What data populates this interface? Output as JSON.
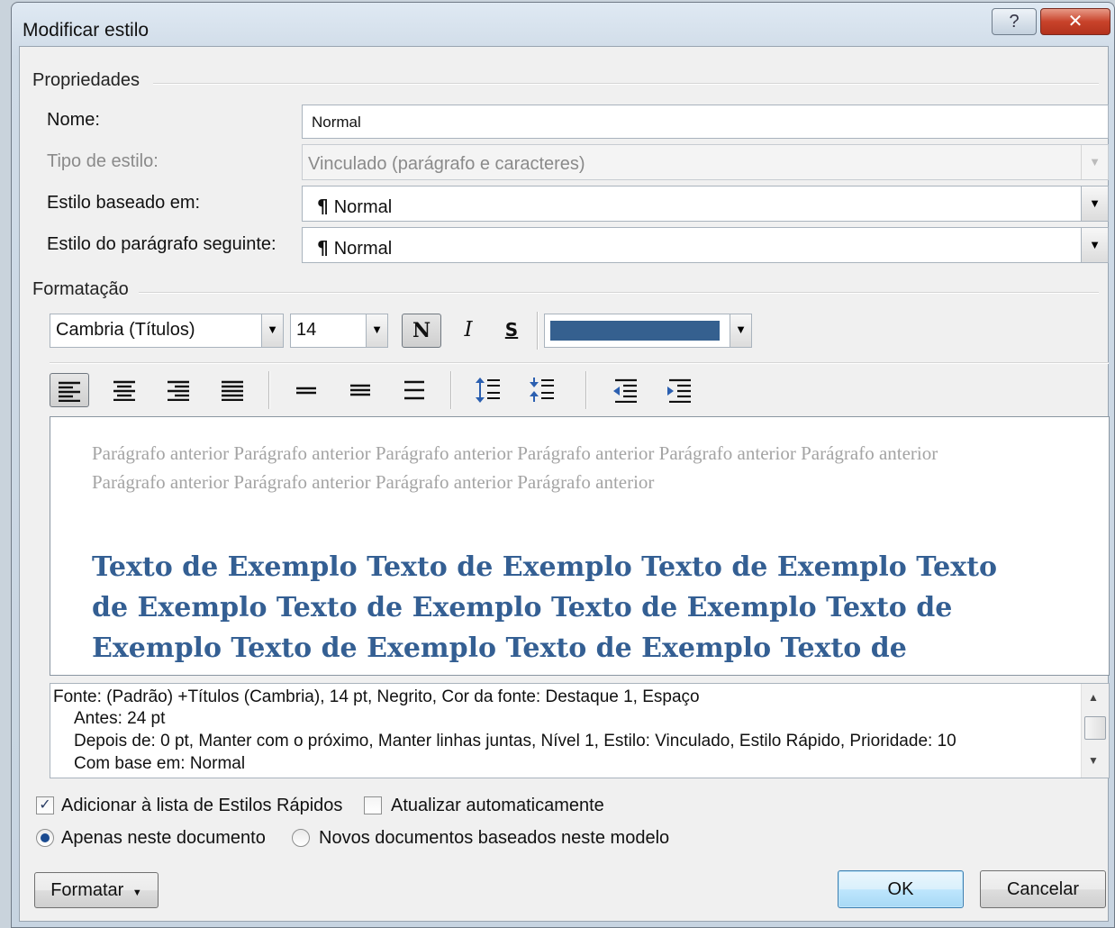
{
  "window": {
    "title": "Modificar estilo",
    "help_glyph": "?",
    "close_glyph": "✕"
  },
  "properties": {
    "group_label": "Propriedades",
    "name_label": "Nome:",
    "name_value": "Normal",
    "type_label": "Tipo de estilo:",
    "type_value": "Vinculado (parágrafo e caracteres)",
    "based_on_label": "Estilo baseado em:",
    "based_on_value": "Normal",
    "next_label": "Estilo do parágrafo seguinte:",
    "next_value": "Normal",
    "pilcrow_glyph": "¶"
  },
  "formatting": {
    "group_label": "Formatação",
    "font_value": "Cambria (Títulos)",
    "size_value": "14",
    "bold_glyph": "N",
    "italic_glyph": "I",
    "underline_glyph": "S",
    "font_color": "#35608f",
    "bold_active": true,
    "alignment_selected": "left"
  },
  "preview": {
    "previous_paragraph": "Parágrafo anterior Parágrafo anterior Parágrafo anterior Parágrafo anterior Parágrafo anterior Parágrafo anterior Parágrafo anterior Parágrafo anterior Parágrafo anterior Parágrafo anterior",
    "sample_text": "Texto de Exemplo Texto de Exemplo Texto de Exemplo Texto de Exemplo Texto de Exemplo Texto de Exemplo Texto de Exemplo Texto de Exemplo Texto de Exemplo Texto de Exemplo Texto de",
    "sample_color": "#345f93"
  },
  "description": {
    "line1": "Fonte: (Padrão) +Títulos (Cambria), 14 pt, Negrito, Cor da fonte: Destaque 1, Espaço",
    "line2": "Antes:  24 pt",
    "line3": "Depois de:  0 pt, Manter com o próximo, Manter linhas juntas, Nível 1, Estilo: Vinculado, Estilo Rápido, Prioridade: 10",
    "line4": "Com base em: Normal"
  },
  "options": {
    "add_quick_styles": {
      "label": "Adicionar à lista de Estilos Rápidos",
      "checked": true
    },
    "auto_update": {
      "label": "Atualizar automaticamente",
      "checked": false
    },
    "only_this_doc": {
      "label": "Apenas neste documento",
      "selected": true
    },
    "new_docs": {
      "label": "Novos documentos baseados neste modelo",
      "selected": false
    }
  },
  "buttons": {
    "format_label": "Formatar",
    "ok_label": "OK",
    "cancel_label": "Cancelar"
  }
}
